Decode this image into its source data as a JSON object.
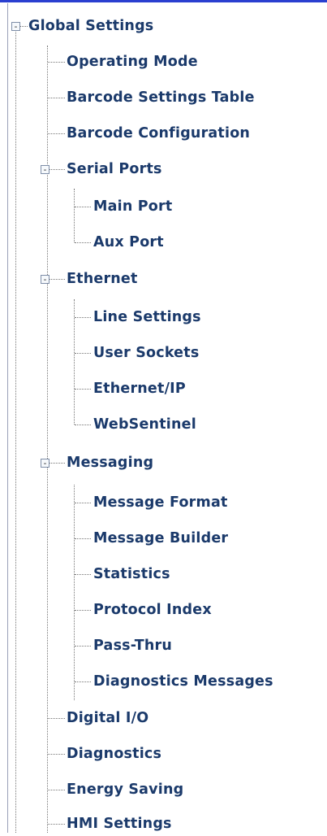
{
  "tree": {
    "global_settings": "Global Settings",
    "operating_mode": "Operating Mode",
    "barcode_settings_table": "Barcode Settings Table",
    "barcode_configuration": "Barcode Configuration",
    "serial_ports": {
      "label": "Serial Ports",
      "main_port": "Main Port",
      "aux_port": "Aux Port"
    },
    "ethernet": {
      "label": "Ethernet",
      "line_settings": "Line Settings",
      "user_sockets": "User Sockets",
      "ethernet_ip": "Ethernet/IP",
      "websentinel": "WebSentinel"
    },
    "messaging": {
      "label": "Messaging",
      "message_format": "Message Format",
      "message_builder": "Message Builder",
      "statistics": "Statistics",
      "protocol_index": "Protocol Index",
      "pass_thru": "Pass-Thru",
      "diagnostics_messages": "Diagnostics Messages"
    },
    "digital_io": "Digital I/O",
    "diagnostics": "Diagnostics",
    "energy_saving": "Energy Saving",
    "hmi_settings": "HMI Settings",
    "expanded_symbol": "-"
  },
  "colors": {
    "link": "#1b3a6b",
    "frame_top": "#2a3fd0",
    "guide": "#777777"
  }
}
